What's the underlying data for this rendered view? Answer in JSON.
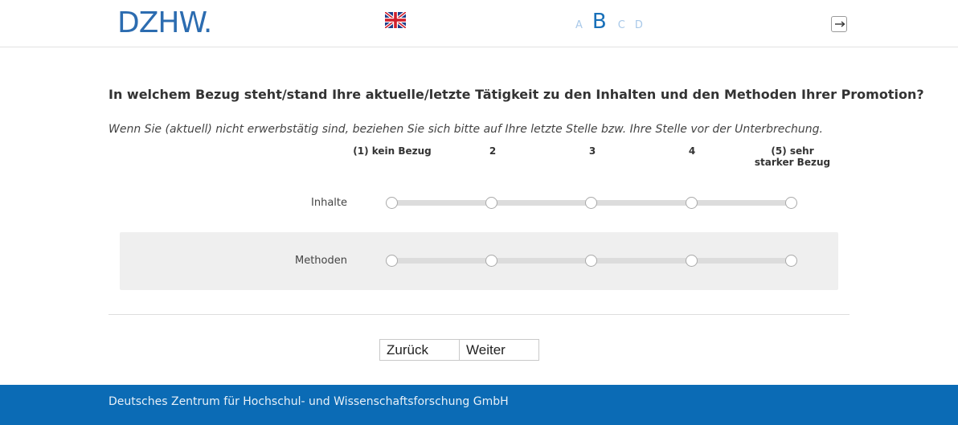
{
  "header": {
    "logo_text": "DZHW.",
    "language_flag_icon": "uk-flag-icon",
    "versions": [
      {
        "label": "A",
        "active": false
      },
      {
        "label": "B",
        "active": true
      },
      {
        "label": "C",
        "active": false
      },
      {
        "label": "D",
        "active": false
      }
    ],
    "logout_icon": "logout-arrow-icon"
  },
  "question": {
    "text": "In welchem Bezug steht/stand Ihre aktuelle/letzte Tätigkeit zu den Inhalten und den Methoden Ihrer Promotion?",
    "hint": "Wenn Sie (aktuell) nicht erwerbstätig sind, beziehen Sie sich bitte auf Ihre letzte Stelle bzw. Ihre Stelle vor der Unterbrechung.",
    "scale": [
      "(1) kein Bezug",
      "2",
      "3",
      "4",
      "(5) sehr starker Bezug"
    ],
    "rows": [
      {
        "label": "Inhalte",
        "selected": null
      },
      {
        "label": "Methoden",
        "selected": null
      }
    ]
  },
  "navigation": {
    "back_label": "Zurück",
    "next_label": "Weiter"
  },
  "footer": {
    "text": "Deutsches Zentrum für Hochschul- und Wissenschaftsforschung GmbH"
  },
  "colors": {
    "brand_blue": "#1870b9",
    "footer_blue": "#0b6bb5",
    "row_highlight": "#efefef"
  }
}
